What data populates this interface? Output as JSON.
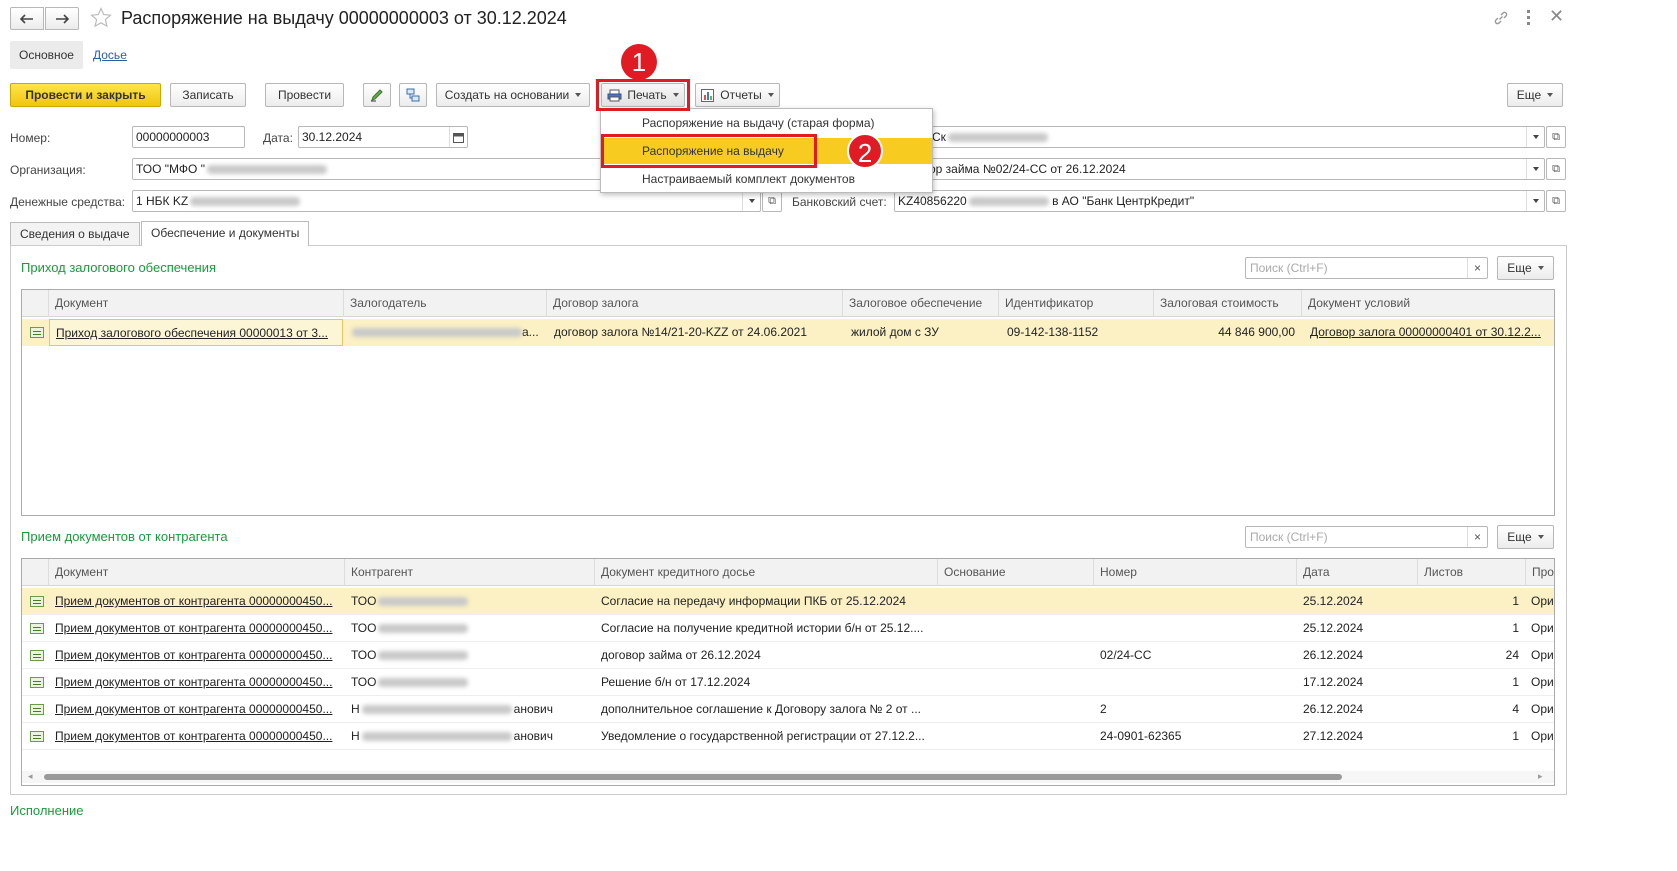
{
  "window": {
    "title": "Распоряжение на выдачу 00000000003 от 30.12.2024"
  },
  "subnav": {
    "main": "Основное",
    "dossier": "Досье"
  },
  "toolbar": {
    "post_close": "Провести и закрыть",
    "save": "Записать",
    "post": "Провести",
    "create_based": "Создать на основании",
    "print": "Печать",
    "reports": "Отчеты",
    "more": "Еще"
  },
  "print_menu": {
    "items": [
      "Распоряжение на выдачу (старая форма)",
      "Распоряжение на выдачу",
      "Настраиваемый комплект документов"
    ]
  },
  "annotations": {
    "step1": "1",
    "step2": "2"
  },
  "form": {
    "number_label": "Номер:",
    "number_value": "00000000003",
    "date_label": "Дата:",
    "date_value": "30.12.2024",
    "right1_value": "Ск",
    "org_label": "Организация:",
    "org_value": "ТОО \"МФО \"",
    "contract_value": "ор займа №02/24-СС от 26.12.2024",
    "funds_label": "Денежные средства:",
    "funds_value": "1 НБК KZ",
    "bank_label": "Банковский счет:",
    "bank_prefix": "KZ40856220",
    "bank_suffix": "в АО \"Банк ЦентрКредит\""
  },
  "tabs": {
    "issue_info": "Сведения о выдаче",
    "collateral_docs": "Обеспечение и документы"
  },
  "collateral_section": {
    "title": "Приход залогового обеспечения",
    "search_placeholder": "Поиск (Ctrl+F)",
    "more": "Еще",
    "columns": [
      "Документ",
      "Залогодатель",
      "Договор залога",
      "Залоговое обеспечение",
      "Идентификатор",
      "Залоговая стоимость",
      "Документ условий"
    ],
    "rows": [
      {
        "doc": "Приход залогового обеспечения 00000013 от 3...",
        "pledger_suffix": "а...",
        "contract": "договор залога №14/21-20-KZZ от 24.06.2021",
        "security": "жилой дом с ЗУ",
        "ident": "09-142-138-1152",
        "value": "44 846 900,00",
        "terms": "Договор залога 00000000401 от 30.12.2..."
      }
    ]
  },
  "docs_section": {
    "title": "Прием документов от контрагента",
    "search_placeholder": "Поиск (Ctrl+F)",
    "more": "Еще",
    "columns": [
      "Документ",
      "Контрагент",
      "Документ кредитного досье",
      "Основание",
      "Номер",
      "Дата",
      "Листов",
      "Про"
    ],
    "rows": [
      {
        "doc": "Прием документов от контрагента 00000000450...",
        "agent": "ТОО",
        "dossier": "Согласие на передачу информации ПКБ от 25.12.2024",
        "num": "",
        "date": "25.12.2024",
        "sheets": "1",
        "extra": "Ори"
      },
      {
        "doc": "Прием документов от контрагента 00000000450...",
        "agent": "ТОО",
        "dossier": "Согласие на получение кредитной истории б/н от 25.12....",
        "num": "",
        "date": "25.12.2024",
        "sheets": "1",
        "extra": "Ори"
      },
      {
        "doc": "Прием документов от контрагента 00000000450...",
        "agent": "ТОО",
        "dossier": "договор займа от 26.12.2024",
        "num": "02/24-СС",
        "date": "26.12.2024",
        "sheets": "24",
        "extra": "Ори"
      },
      {
        "doc": "Прием документов от контрагента 00000000450...",
        "agent": "ТОО",
        "dossier": "Решение б/н от 17.12.2024",
        "num": "",
        "date": "17.12.2024",
        "sheets": "1",
        "extra": "Ори"
      },
      {
        "doc": "Прием документов от контрагента 00000000450...",
        "agent": "Н",
        "agent_suffix": "анович",
        "dossier": "дополнительное соглашение к Договору залога № 2 от ...",
        "num": "2",
        "date": "26.12.2024",
        "sheets": "4",
        "extra": "Ори"
      },
      {
        "doc": "Прием документов от контрагента 00000000450...",
        "agent": "Н",
        "agent_suffix": "анович",
        "dossier": "Уведомление о государственной регистрации от 27.12.2...",
        "num": "24-0901-62365",
        "date": "27.12.2024",
        "sheets": "1",
        "extra": "Ори"
      }
    ]
  },
  "footer": {
    "execution": "Исполнение"
  },
  "colors": {
    "primary_button": "#f1c40f",
    "selected_row": "#fbf1c4",
    "menu_highlight": "#f8cb21",
    "section_title": "#1a9a3b",
    "annotation_red": "#e01b24"
  }
}
